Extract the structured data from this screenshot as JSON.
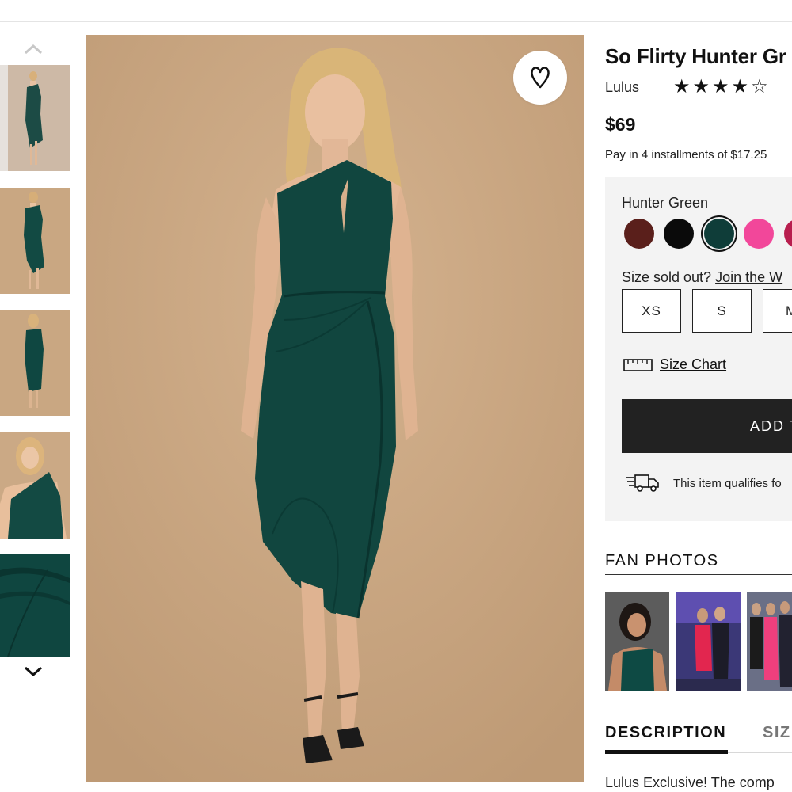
{
  "product": {
    "title": "So Flirty Hunter Gr",
    "brand": "Lulus",
    "rating": 4,
    "rating_max": 5,
    "stars": [
      "★",
      "★",
      "★",
      "★",
      "☆"
    ],
    "price": "$69",
    "installments": "Pay in 4 installments of $17.25"
  },
  "options": {
    "selected_color_name": "Hunter Green",
    "swatches": [
      {
        "name": "burgundy-brown",
        "color": "#5a1f1b"
      },
      {
        "name": "black",
        "color": "#0a0a0a"
      },
      {
        "name": "hunter-green",
        "color": "#0f3d39"
      },
      {
        "name": "hot-pink",
        "color": "#f2479a"
      },
      {
        "name": "magenta",
        "color": "#b81e4e"
      }
    ],
    "size_message": "Size sold out?",
    "size_link": "Join the W",
    "sizes": [
      "XS",
      "S",
      "M"
    ],
    "size_chart_label": "Size Chart",
    "add_to_bag_label": "ADD T",
    "shipping_text": "This item qualifies fo"
  },
  "fan_photos": {
    "title": "FAN PHOTOS"
  },
  "tabs": {
    "description": "DESCRIPTION",
    "size": "SIZ"
  },
  "description_text": "Lulus Exclusive! The comp",
  "colors": {
    "dress_green": "#0f4a44",
    "backdrop": "#caa781",
    "dark_button": "#222222",
    "panel_bg": "#f3f3f3"
  }
}
